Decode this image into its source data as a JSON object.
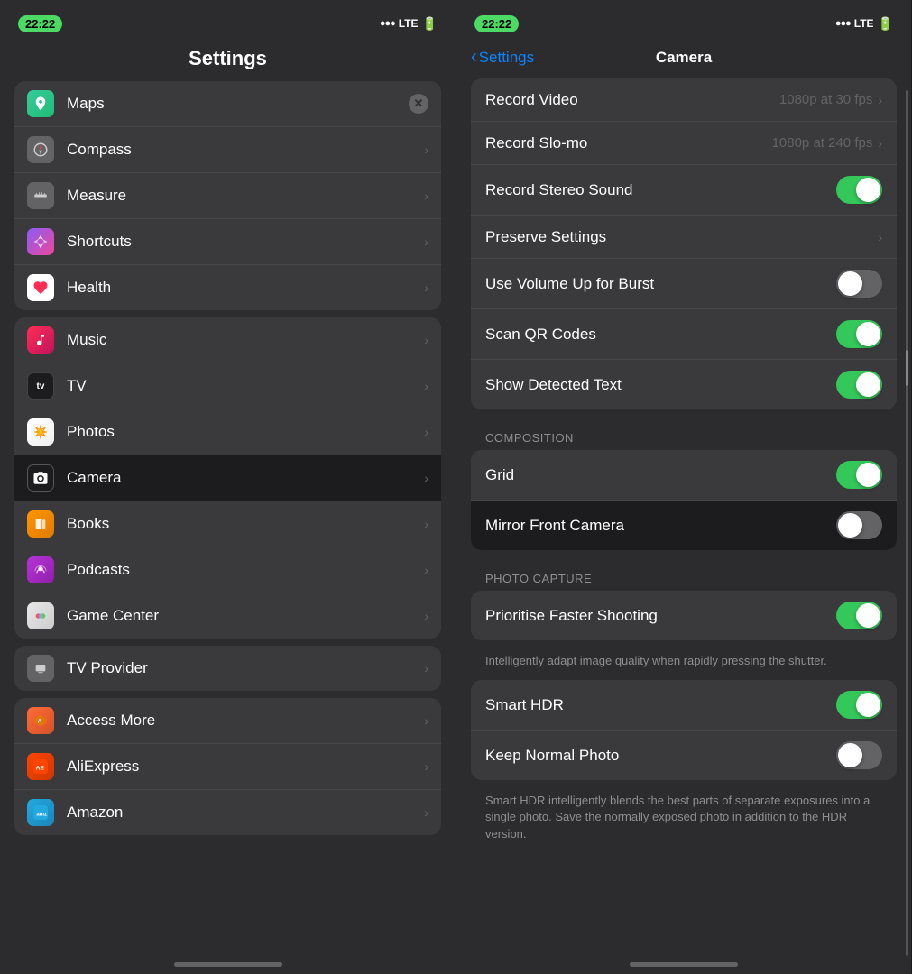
{
  "left": {
    "status": {
      "time": "22:22",
      "lte": "LTE",
      "signal": "▲▲▲"
    },
    "title": "Settings",
    "section1": [
      {
        "id": "maps",
        "label": "Maps",
        "icon": "maps",
        "hasClose": true
      },
      {
        "id": "compass",
        "label": "Compass",
        "icon": "compass",
        "hasClose": false
      },
      {
        "id": "measure",
        "label": "Measure",
        "icon": "measure",
        "hasClose": false
      },
      {
        "id": "shortcuts",
        "label": "Shortcuts",
        "icon": "shortcuts",
        "hasClose": false
      },
      {
        "id": "health",
        "label": "Health",
        "icon": "health",
        "hasClose": false
      }
    ],
    "section2": [
      {
        "id": "music",
        "label": "Music",
        "icon": "music",
        "selected": false
      },
      {
        "id": "tv",
        "label": "TV",
        "icon": "tv",
        "selected": false
      },
      {
        "id": "photos",
        "label": "Photos",
        "icon": "photos",
        "selected": false
      },
      {
        "id": "camera",
        "label": "Camera",
        "icon": "camera",
        "selected": true
      },
      {
        "id": "books",
        "label": "Books",
        "icon": "books",
        "selected": false
      },
      {
        "id": "podcasts",
        "label": "Podcasts",
        "icon": "podcasts",
        "selected": false
      },
      {
        "id": "gamecenter",
        "label": "Game Center",
        "icon": "gamecenter",
        "selected": false
      }
    ],
    "section3": [
      {
        "id": "tvprovider",
        "label": "TV Provider",
        "icon": "tvprovider",
        "selected": false
      }
    ],
    "section4": [
      {
        "id": "accessmore",
        "label": "Access More",
        "icon": "accessmore",
        "selected": false
      },
      {
        "id": "aliexpress",
        "label": "AliExpress",
        "icon": "aliexpress",
        "selected": false
      },
      {
        "id": "amazon",
        "label": "Amazon",
        "icon": "amazon",
        "selected": false
      }
    ]
  },
  "right": {
    "status": {
      "time": "22:22",
      "lte": "LTE",
      "signal": "▲▲▲"
    },
    "nav": {
      "back_label": "Settings",
      "title": "Camera"
    },
    "rows": [
      {
        "id": "record-video",
        "label": "Record Video",
        "value": "1080p at 30 fps",
        "type": "chevron",
        "toggle": null
      },
      {
        "id": "record-slomo",
        "label": "Record Slo-mo",
        "value": "1080p at 240 fps",
        "type": "chevron",
        "toggle": null
      },
      {
        "id": "record-stereo",
        "label": "Record Stereo Sound",
        "value": "",
        "type": "toggle",
        "toggle": "on"
      },
      {
        "id": "preserve-settings",
        "label": "Preserve Settings",
        "value": "",
        "type": "chevron",
        "toggle": null
      },
      {
        "id": "volume-burst",
        "label": "Use Volume Up for Burst",
        "value": "",
        "type": "toggle",
        "toggle": "off"
      },
      {
        "id": "scan-qr",
        "label": "Scan QR Codes",
        "value": "",
        "type": "toggle",
        "toggle": "on"
      },
      {
        "id": "show-detected-text",
        "label": "Show Detected Text",
        "value": "",
        "type": "toggle",
        "toggle": "on"
      }
    ],
    "composition_header": "COMPOSITION",
    "composition_rows": [
      {
        "id": "grid",
        "label": "Grid",
        "type": "toggle",
        "toggle": "on",
        "selected": false
      },
      {
        "id": "mirror-front",
        "label": "Mirror Front Camera",
        "type": "toggle",
        "toggle": "off",
        "selected": true
      }
    ],
    "photocapture_header": "PHOTO CAPTURE",
    "photocapture_rows": [
      {
        "id": "prioritise-shooting",
        "label": "Prioritise Faster Shooting",
        "type": "toggle",
        "toggle": "on",
        "selected": false
      }
    ],
    "photocapture_footer": "Intelligently adapt image quality when rapidly pressing the shutter.",
    "photocapture2_rows": [
      {
        "id": "smart-hdr",
        "label": "Smart HDR",
        "type": "toggle",
        "toggle": "on",
        "selected": false
      },
      {
        "id": "keep-normal",
        "label": "Keep Normal Photo",
        "type": "toggle",
        "toggle": "off",
        "selected": false
      }
    ],
    "photocapture2_footer": "Smart HDR intelligently blends the best parts of separate exposures into a single photo. Save the normally exposed photo in addition to the HDR version."
  }
}
